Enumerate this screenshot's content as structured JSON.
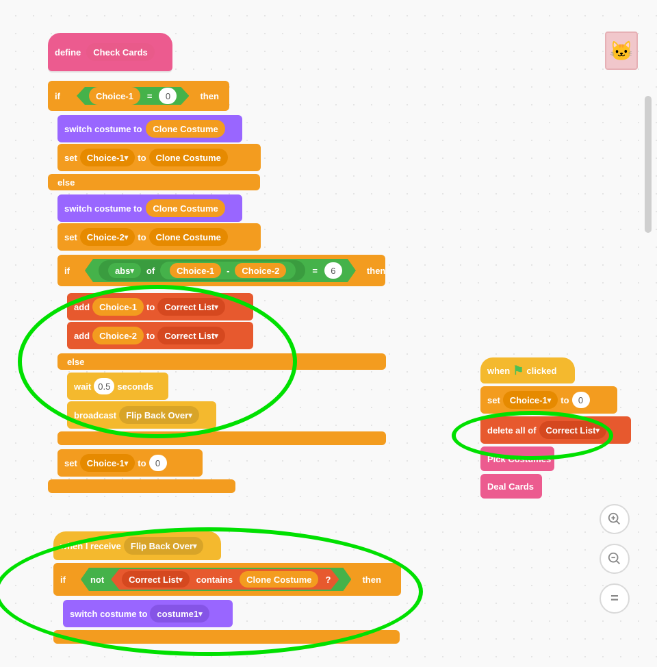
{
  "define": {
    "label": "define",
    "proc": "Check Cards"
  },
  "ifthen": {
    "if": "if",
    "then": "then",
    "else": "else"
  },
  "choice1": "Choice-1",
  "choice2": "Choice-2",
  "equals": "=",
  "zero": "0",
  "switchCostume": "switch costume to",
  "cloneCostume": "Clone Costume",
  "set": "set",
  "to": "to",
  "absOf": {
    "abs": "abs",
    "of": "of",
    "minus": "-",
    "six": "6"
  },
  "add": "add",
  "correctList": "Correct List",
  "wait": {
    "label": "wait",
    "secs": "0.5",
    "unit": "seconds"
  },
  "broadcast": {
    "label": "broadcast",
    "msg": "Flip Back Over"
  },
  "whenReceive": {
    "label": "when I receive",
    "msg": "Flip Back Over"
  },
  "not": "not",
  "contains": "contains",
  "q": "?",
  "costume1": "costume1",
  "whenFlag": {
    "when": "when",
    "clicked": "clicked"
  },
  "deleteAll": "delete all of",
  "pickCostumes": "Pick Costumes",
  "dealCards": "Deal Cards"
}
